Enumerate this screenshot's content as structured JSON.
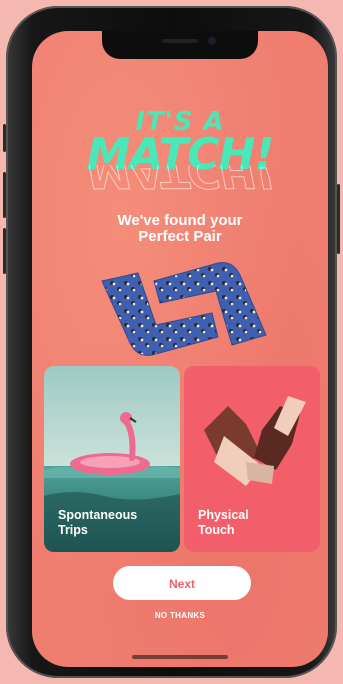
{
  "match_screen": {
    "headline_top": "IT'S A",
    "headline_main": "MATCH!",
    "subtitle_line1": "We've found your",
    "subtitle_line2": "Perfect Pair"
  },
  "cards": [
    {
      "line1": "Spontaneous",
      "line2": "Trips"
    },
    {
      "line1": "Physical",
      "line2": "Touch"
    }
  ],
  "actions": {
    "next_label": "Next",
    "no_thanks_label": "NO THANKS"
  },
  "colors": {
    "background": "#ef7e70",
    "accent_teal": "#48e8b8",
    "card_right": "#f25f6a",
    "button_text": "#ef5f6c",
    "sock_blue": "#3f5fb0"
  },
  "icons": {
    "socks": "socks-illustration",
    "flamingo": "flamingo-float-photo",
    "hands": "holding-hands-illustration"
  }
}
